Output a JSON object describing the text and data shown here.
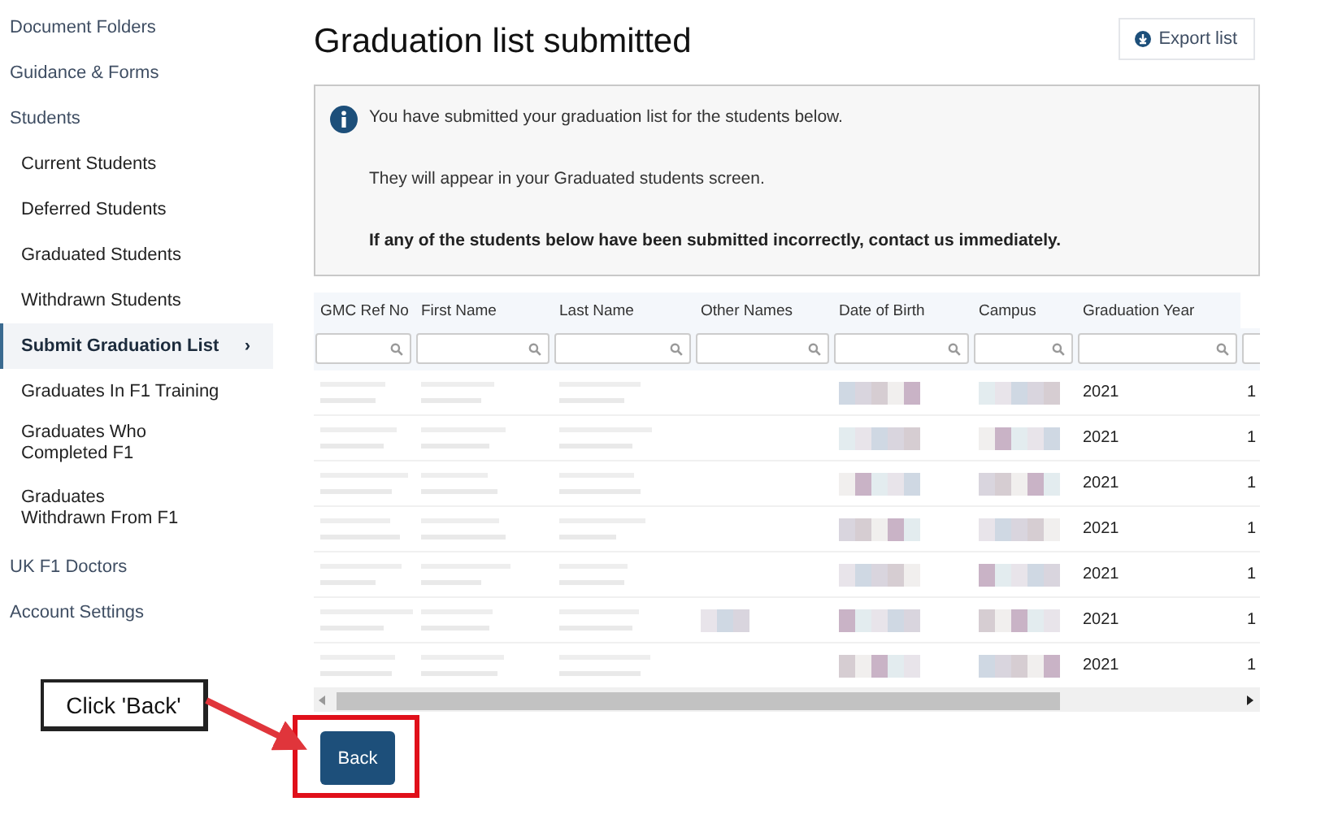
{
  "sidebar": {
    "items": [
      {
        "label": "Document Folders",
        "selected": false
      },
      {
        "label": "Guidance & Forms",
        "selected": false
      },
      {
        "label": "Students",
        "selected": false,
        "children": [
          {
            "label": "Current Students",
            "selected": false
          },
          {
            "label": "Deferred Students",
            "selected": false
          },
          {
            "label": "Graduated Students",
            "selected": false
          },
          {
            "label": "Withdrawn Students",
            "selected": false
          },
          {
            "label": "Submit Graduation List",
            "selected": true,
            "chevron": "›"
          },
          {
            "label": "Graduates In F1 Training",
            "selected": false
          },
          {
            "label": "Graduates Who Completed F1",
            "selected": false
          },
          {
            "label": "Graduates Withdrawn From F1",
            "selected": false
          }
        ]
      },
      {
        "label": "UK F1 Doctors",
        "selected": false
      },
      {
        "label": "Account Settings",
        "selected": false
      }
    ]
  },
  "page": {
    "title": "Graduation list submitted",
    "export_button": "Export list"
  },
  "info_box": {
    "lines": [
      {
        "text": "You have submitted your graduation list for the students below.",
        "bold": false
      },
      {
        "text": "They will appear in your Graduated students screen.",
        "bold": false
      },
      {
        "text": "If any of the students below have been submitted incorrectly, contact us immediately.",
        "bold": true
      }
    ]
  },
  "table": {
    "columns": [
      "GMC Ref No",
      "First Name",
      "Last Name",
      "Other Names",
      "Date of Birth",
      "Campus",
      "Graduation Year"
    ],
    "rows": [
      {
        "cells": [
          {
            "kind": "blurred"
          },
          {
            "kind": "blurred"
          },
          {
            "kind": "blurred"
          },
          {
            "kind": "empty"
          },
          {
            "kind": "blurred"
          },
          {
            "kind": "blurred"
          },
          {
            "kind": "text",
            "text": "2021"
          },
          {
            "kind": "text",
            "text": "1"
          }
        ]
      },
      {
        "cells": [
          {
            "kind": "blurred"
          },
          {
            "kind": "blurred"
          },
          {
            "kind": "blurred"
          },
          {
            "kind": "empty"
          },
          {
            "kind": "blurred"
          },
          {
            "kind": "blurred"
          },
          {
            "kind": "text",
            "text": "2021"
          },
          {
            "kind": "text",
            "text": "1"
          }
        ]
      },
      {
        "cells": [
          {
            "kind": "blurred"
          },
          {
            "kind": "blurred"
          },
          {
            "kind": "blurred"
          },
          {
            "kind": "empty"
          },
          {
            "kind": "blurred"
          },
          {
            "kind": "blurred"
          },
          {
            "kind": "text",
            "text": "2021"
          },
          {
            "kind": "text",
            "text": "1"
          }
        ]
      },
      {
        "cells": [
          {
            "kind": "blurred"
          },
          {
            "kind": "blurred"
          },
          {
            "kind": "blurred"
          },
          {
            "kind": "empty"
          },
          {
            "kind": "blurred"
          },
          {
            "kind": "blurred"
          },
          {
            "kind": "text",
            "text": "2021"
          },
          {
            "kind": "text",
            "text": "1"
          }
        ]
      },
      {
        "cells": [
          {
            "kind": "blurred"
          },
          {
            "kind": "blurred"
          },
          {
            "kind": "blurred"
          },
          {
            "kind": "empty"
          },
          {
            "kind": "blurred"
          },
          {
            "kind": "blurred"
          },
          {
            "kind": "text",
            "text": "2021"
          },
          {
            "kind": "text",
            "text": "1"
          }
        ]
      },
      {
        "cells": [
          {
            "kind": "blurred"
          },
          {
            "kind": "blurred"
          },
          {
            "kind": "blurred"
          },
          {
            "kind": "blurred"
          },
          {
            "kind": "blurred"
          },
          {
            "kind": "blurred"
          },
          {
            "kind": "text",
            "text": "2021"
          },
          {
            "kind": "text",
            "text": "1"
          }
        ]
      },
      {
        "cells": [
          {
            "kind": "blurred"
          },
          {
            "kind": "blurred"
          },
          {
            "kind": "blurred"
          },
          {
            "kind": "empty"
          },
          {
            "kind": "blurred"
          },
          {
            "kind": "blurred"
          },
          {
            "kind": "text",
            "text": "2021"
          },
          {
            "kind": "text",
            "text": "1"
          }
        ]
      }
    ]
  },
  "back_button": "Back",
  "annotation": {
    "callout": "Click 'Back'"
  }
}
